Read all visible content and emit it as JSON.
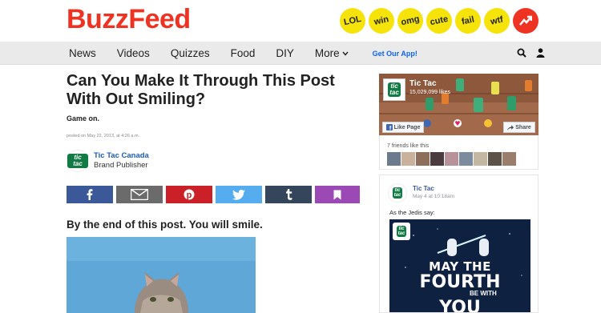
{
  "header": {
    "logo": "BuzzFeed",
    "badges": [
      {
        "label": "LOL",
        "icon": "lol-badge"
      },
      {
        "label": "win",
        "icon": "win-badge"
      },
      {
        "label": "omg",
        "icon": "omg-badge"
      },
      {
        "label": "cute",
        "icon": "cute-badge"
      },
      {
        "label": "fail",
        "icon": "fail-badge"
      },
      {
        "label": "wtf",
        "icon": "wtf-badge"
      },
      {
        "label": "",
        "icon": "trending-icon"
      }
    ]
  },
  "nav": {
    "items": [
      "News",
      "Videos",
      "Quizzes",
      "Food",
      "DIY"
    ],
    "more_label": "More",
    "cta": "Get Our App!",
    "icons": [
      "search-icon",
      "user-icon"
    ]
  },
  "article": {
    "title": "Can You Make It Through This Post With Out Smiling?",
    "subtitle": "Game on.",
    "posted": "posted on May 22, 2013, at 4:26 a.m.",
    "author": {
      "name": "Tic Tac Canada",
      "role": "Brand Publisher",
      "logo_text": "tic tac"
    },
    "share_buttons": [
      "facebook-icon",
      "mail-icon",
      "pinterest-icon",
      "twitter-icon",
      "tumblr-icon",
      "bookmark-icon"
    ],
    "lead": "By the end of this post. You will smile."
  },
  "sidebar": {
    "fb_page": {
      "name": "Tic Tac",
      "likes": "15,029,099 likes",
      "like_button": "Like Page",
      "share_button": "Share",
      "friends_text": "7 friends like this"
    },
    "post": {
      "author": "Tic Tac",
      "date": "May 4 at 10:18am",
      "text": "As the Jedis say:",
      "image_text": {
        "line1": "MAY THE",
        "line2": "FOURTH",
        "line3": "BE WITH",
        "line4": "YOU"
      }
    }
  },
  "colors": {
    "brand_red": "#ee3322",
    "badge_yellow": "#f5e30a",
    "link_blue": "#1a5bb8",
    "facebook": "#3b5998",
    "pinterest": "#cb2027",
    "twitter": "#55acee",
    "tumblr": "#35465c",
    "save": "#9b49b5"
  }
}
